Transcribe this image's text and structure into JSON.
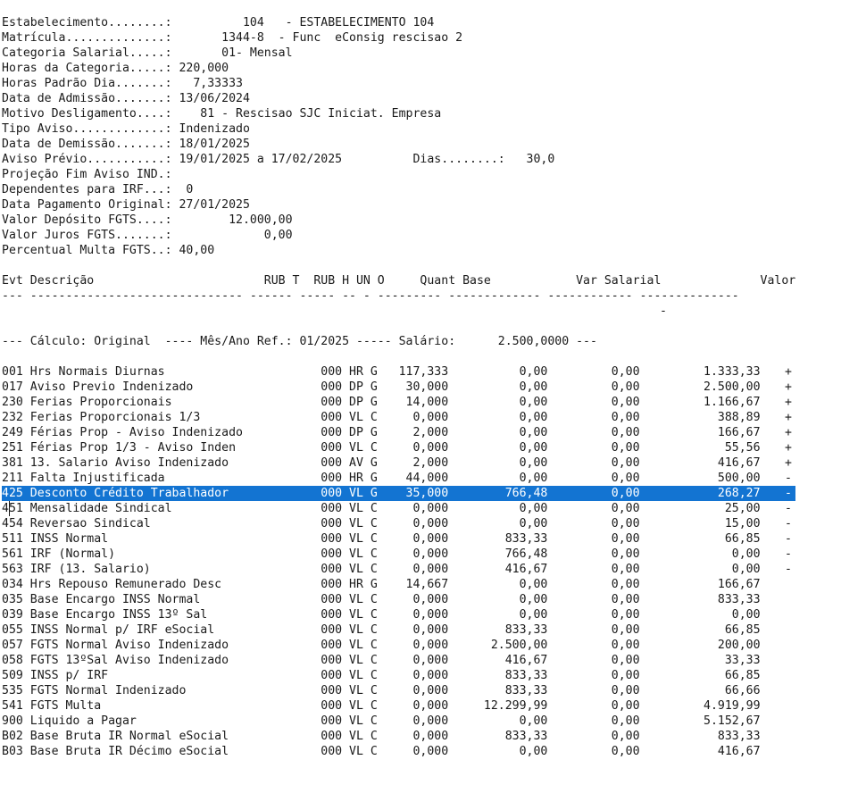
{
  "header_lines": [
    "Estabelecimento........:          104   - ESTABELECIMENTO 104",
    "Matrícula..............:       1344-8  - Func  eConsig rescisao 2",
    "Categoria Salarial.....:       01- Mensal",
    "Horas da Categoria.....: 220,000",
    "Horas Padrão Dia.......:   7,33333",
    "Data de Admissão.......: 13/06/2024",
    "Motivo Desligamento....:    81 - Rescisao SJC Iniciat. Empresa",
    "Tipo Aviso.............: Indenizado",
    "Data de Demissão.......: 18/01/2025",
    "Aviso Prévio...........: 19/01/2025 a 17/02/2025          Dias........:   30,0",
    "Projeção Fim Aviso IND.:",
    "Dependentes para IRF...:  0",
    "Data Pagamento Original: 27/01/2025",
    "Valor Depósito FGTS....:        12.000,00",
    "Valor Juros FGTS.......:             0,00",
    "Percentual Multa FGTS..: 40,00"
  ],
  "table_header": "Evt Descrição                        RUB T  RUB H UN O     Quant Base            Var Salarial              Valor",
  "table_rule": "--- ------------------------------ ------ ----- -- - --------- ------------- ------------ --------------",
  "rule_mark": "-",
  "calc_line": "--- Cálculo: Original  ---- Mês/Ano Ref.: 01/2025 ----- Salário:      2.500,0000 ---",
  "rows": [
    {
      "text": "001 Hrs Normais Diurnas                      000 HR G   117,333          0,00         0,00         1.333,33",
      "sign": "+"
    },
    {
      "text": "017 Aviso Previo Indenizado                  000 DP G    30,000          0,00         0,00         2.500,00",
      "sign": "+"
    },
    {
      "text": "230 Ferias Proporcionais                     000 DP G    14,000          0,00         0,00         1.166,67",
      "sign": "+"
    },
    {
      "text": "232 Ferias Proporcionais 1/3                 000 VL C     0,000          0,00         0,00           388,89",
      "sign": "+"
    },
    {
      "text": "249 Férias Prop - Aviso Indenizado           000 DP G     2,000          0,00         0,00           166,67",
      "sign": "+"
    },
    {
      "text": "251 Férias Prop 1/3 - Aviso Inden            000 VL C     0,000          0,00         0,00            55,56",
      "sign": "+"
    },
    {
      "text": "381 13. Salario Aviso Indenizado             000 AV G     2,000          0,00         0,00           416,67",
      "sign": "+"
    },
    {
      "text": "211 Falta Injustificada                      000 HR G    44,000          0,00         0,00           500,00",
      "sign": "-"
    },
    {
      "text": "425 Desconto Crédito Trabalhador             000 VL G    35,000        766,48         0,00           268,27",
      "sign": "-"
    },
    {
      "text": "451 Mensalidade Sindical                     000 VL C     0,000          0,00         0,00            25,00",
      "sign": "-"
    },
    {
      "text": "454 Reversao Sindical                        000 VL C     0,000          0,00         0,00            15,00",
      "sign": "-"
    },
    {
      "text": "511 INSS Normal                              000 VL C     0,000        833,33         0,00            66,85",
      "sign": "-"
    },
    {
      "text": "561 IRF (Normal)                             000 VL C     0,000        766,48         0,00             0,00",
      "sign": "-"
    },
    {
      "text": "563 IRF (13. Salario)                        000 VL C     0,000        416,67         0,00             0,00",
      "sign": "-"
    },
    {
      "text": "034 Hrs Repouso Remunerado Desc              000 HR G    14,667          0,00         0,00           166,67",
      "sign": ""
    },
    {
      "text": "035 Base Encargo INSS Normal                 000 VL C     0,000          0,00         0,00           833,33",
      "sign": ""
    },
    {
      "text": "039 Base Encargo INSS 13º Sal                000 VL C     0,000          0,00         0,00             0,00",
      "sign": ""
    },
    {
      "text": "055 INSS Normal p/ IRF eSocial               000 VL C     0,000        833,33         0,00            66,85",
      "sign": ""
    },
    {
      "text": "057 FGTS Normal Aviso Indenizado             000 VL C     0,000      2.500,00         0,00           200,00",
      "sign": ""
    },
    {
      "text": "058 FGTS 13ºSal Aviso Indenizado             000 VL C     0,000        416,67         0,00            33,33",
      "sign": ""
    },
    {
      "text": "509 INSS p/ IRF                              000 VL C     0,000        833,33         0,00            66,85",
      "sign": ""
    },
    {
      "text": "535 FGTS Normal Indenizado                   000 VL C     0,000        833,33         0,00            66,66",
      "sign": ""
    },
    {
      "text": "541 FGTS Multa                               000 VL C     0,000     12.299,99         0,00         4.919,99",
      "sign": ""
    },
    {
      "text": "900 Liquido a Pagar                          000 VL C     0,000          0,00         0,00         5.152,67",
      "sign": ""
    },
    {
      "text": "B02 Base Bruta IR Normal eSocial             000 VL C     0,000        833,33         0,00           833,33",
      "sign": ""
    },
    {
      "text": "B03 Base Bruta IR Décimo eSocial             000 VL C     0,000          0,00         0,00           416,67",
      "sign": ""
    }
  ],
  "selection_color": "#1374d2"
}
